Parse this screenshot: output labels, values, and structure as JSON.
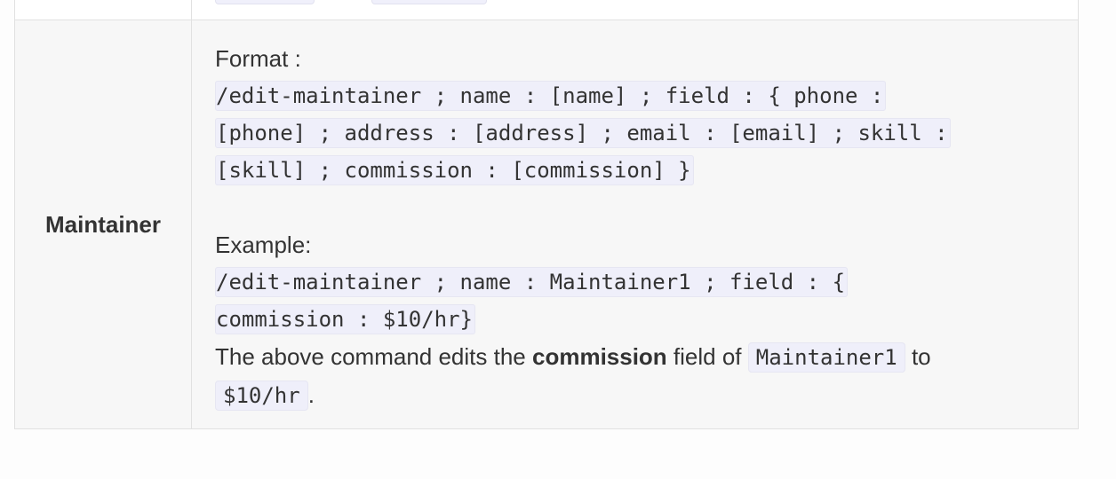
{
  "table": {
    "row": {
      "name": "Maintainer",
      "format_label": "Format :",
      "format_code_lines": [
        "/edit-maintainer ; name : [name] ; field : { phone :",
        "[phone] ; address : [address] ; email : [email] ; skill :",
        "[skill] ; commission : [commission] }"
      ],
      "example_label": "Example:",
      "example_code_lines": [
        "/edit-maintainer ; name : Maintainer1 ; field : {",
        "commission : $10/hr}"
      ],
      "description": {
        "prefix": "The above command edits the ",
        "bold": "commission",
        "middle": " field of ",
        "code_name": "Maintainer1",
        "to": " to",
        "code_value": "$10/hr",
        "suffix": "."
      }
    }
  }
}
